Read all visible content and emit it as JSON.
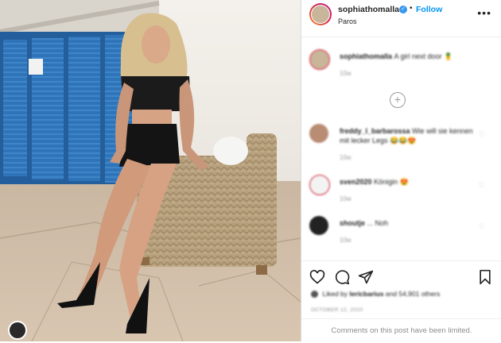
{
  "post": {
    "author": "sophiathomalla",
    "follow_label": "Follow",
    "dot": "•",
    "location": "Paros",
    "more_label": "•••",
    "verified_mark": "✓",
    "caption_author": "sophiathomalla",
    "caption_text": "A girl next door 🍍",
    "caption_time": "10w"
  },
  "comments": [
    {
      "user": "freddy_l_barbarossa",
      "text": "Wie will sie kennen mit lecker Legs 😂😂😍",
      "time": "10w"
    },
    {
      "user": "sven2020",
      "text": "Königin 😍",
      "time": "10w"
    },
    {
      "user": "shoutje",
      "text": "... Noh",
      "time": "10w"
    }
  ],
  "actions": {
    "liked_by_prefix": "Liked by",
    "liked_by_user": "lericbarius",
    "liked_by_suffix": "and 54,901 others",
    "date": "OCTOBER 12, 2020",
    "comments_closed": "Comments on this post have been limited."
  },
  "icons": {
    "like": "heart-icon",
    "comment": "comment-bubble-icon",
    "share": "paper-plane-icon",
    "save": "bookmark-icon",
    "load_more": "plus-circle-icon"
  },
  "colors": {
    "follow": "#0095f6",
    "verified": "#3897f0",
    "shutters": "#2f74b8"
  }
}
